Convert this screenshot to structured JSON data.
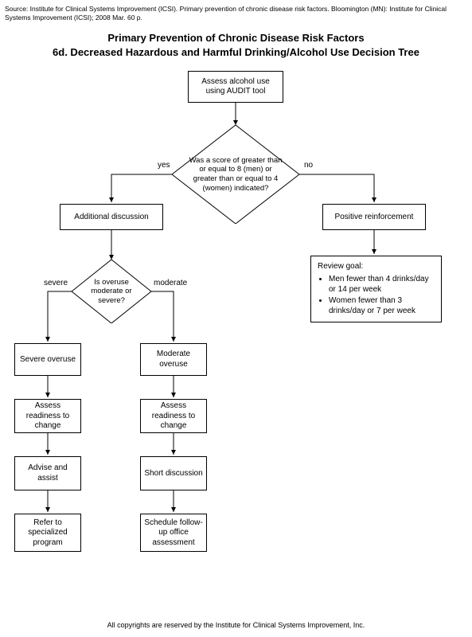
{
  "source": "Source: Institute for Clinical Systems Improvement (ICSI). Primary prevention of chronic disease risk factors. Bloomington (MN): Institute for Clinical Systems Improvement (ICSI); 2008 Mar. 60 p.",
  "title_line1": "Primary Prevention of Chronic Disease Risk Factors",
  "title_line2": "6d. Decreased Hazardous and Harmful Drinking/Alcohol Use Decision Tree",
  "nodes": {
    "start": "Assess alcohol use using AUDIT tool",
    "decision1": "Was a score of greater than or equal to 8 (men) or greater than or equal to 4 (women) indicated?",
    "yes": "yes",
    "no": "no",
    "additional": "Additional discussion",
    "positive": "Positive reinforcement",
    "review_title": "Review goal:",
    "review_b1": "Men fewer than 4 drinks/day or 14 per week",
    "review_b2": "Women fewer than 3 drinks/day or 7 per week",
    "decision2": "Is overuse moderate or severe?",
    "severe": "severe",
    "moderate": "moderate",
    "severe_overuse": "Severe overuse",
    "moderate_overuse": "Moderate overuse",
    "assess_ready_s": "Assess readiness to change",
    "assess_ready_m": "Assess readiness to change",
    "advise_assist": "Advise and assist",
    "short_discussion": "Short discussion",
    "refer": "Refer to specialized program",
    "schedule": "Schedule follow-up office assessment"
  },
  "footer": "All copyrights are reserved by the Institute for Clinical Systems Improvement, Inc."
}
